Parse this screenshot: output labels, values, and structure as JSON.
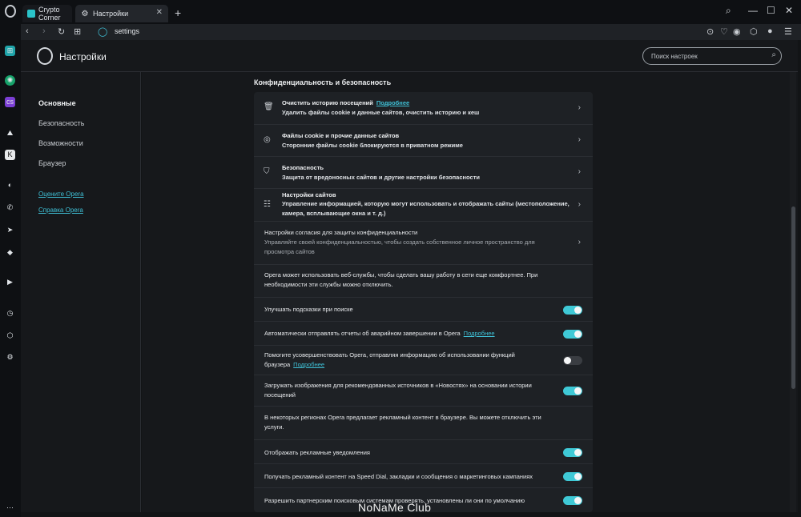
{
  "tabs": [
    {
      "label": "Crypto Corner",
      "icon": "crypto-corner-favicon"
    },
    {
      "label": "Настройки",
      "icon": "gear-icon"
    }
  ],
  "address": {
    "url": "settings"
  },
  "header": {
    "title": "Настройки",
    "search_placeholder": "Поиск настроек"
  },
  "nav": {
    "items": [
      "Основные",
      "Безопасность",
      "Возможности",
      "Браузер"
    ],
    "links": [
      "Оцените Opera",
      "Справка Opera"
    ]
  },
  "section": {
    "title": "Конфиденциальность и безопасность"
  },
  "rows": [
    {
      "icon": "trash-icon",
      "title": "Очистить историю посещений",
      "link": "Подробнее",
      "sub": "Удалить файлы cookie и данные сайтов, очистить историю и кеш"
    },
    {
      "icon": "cookie-icon",
      "title": "Файлы cookie и прочие данные сайтов",
      "sub": "Сторонние файлы cookie блокируются в приватном режиме"
    },
    {
      "icon": "shield-icon",
      "title": "Безопасность",
      "sub": "Защита от вредоносных сайтов и другие настройки безопасности"
    },
    {
      "icon": "sliders-icon",
      "title": "Настройки сайтов",
      "sub": "Управление информацией, которую могут использовать и отображать сайты (местоположение, камера, всплывающие окна и т. д.)"
    }
  ],
  "consent": {
    "title": "Настройки согласия для защиты конфиденциальности",
    "sub": "Управляйте своей конфиденциальностью, чтобы создать собственное личное пространство для просмотра сайтов"
  },
  "webservices_note": "Opera может использовать веб-службы, чтобы сделать вашу работу в сети еще комфортнее. При необходимости эти службы можно отключить.",
  "toggles": [
    {
      "label": "Улучшать подсказки при поиске",
      "on": true
    },
    {
      "label": "Автоматически отправлять отчеты об аварийном завершении в Opera",
      "link": "Подробнее",
      "on": true
    },
    {
      "label": "Помогите усовершенствовать Opera, отправляя информацию об использовании функций браузера",
      "link": "Подробнее",
      "on": false
    },
    {
      "label": "Загружать изображения для рекомендованных источников в «Новостях» на основании истории посещений",
      "on": true
    }
  ],
  "ads_note": "В некоторых регионах Opera предлагает рекламный контент в браузере. Вы можете отключить эти услуги.",
  "ad_toggles": [
    {
      "label": "Отображать рекламные уведомления",
      "on": true
    },
    {
      "label": "Получать рекламный контент на Speed Dial, закладки и сообщения о маркетинговых кампаниях",
      "on": true
    },
    {
      "label": "Разрешить партнерским поисковым системам проверять, установлены ли они по умолчанию",
      "on": true
    }
  ],
  "watermark": "NoNaMe Club",
  "colors": {
    "accent": "#3fc9d6",
    "link": "#3fc0d6",
    "background": "#16181b",
    "card": "#1e2125"
  }
}
